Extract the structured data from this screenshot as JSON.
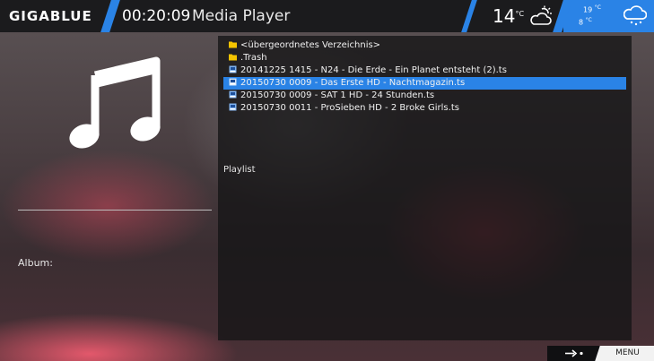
{
  "header": {
    "brand": "GIGABLUE",
    "clock": "00:20:09",
    "title": "Media Player",
    "temperature": "14",
    "temp_unit": "°C",
    "weather_icon": "cloud-sun-icon",
    "forecast": {
      "high": "19",
      "low": "8",
      "unit": "°C",
      "icon": "cloud-rain-icon"
    }
  },
  "info": {
    "cover_icon": "music-note-icon",
    "album_label": "Album:"
  },
  "filelist": {
    "items": [
      {
        "label": "<übergeordnetes Verzeichnis>",
        "icon": "folder-icon",
        "selected": false
      },
      {
        "label": ".Trash",
        "icon": "folder-icon",
        "selected": false
      },
      {
        "label": "20141225 1415 - N24 - Die Erde - Ein Planet entsteht (2).ts",
        "icon": "video-file-icon",
        "selected": false
      },
      {
        "label": "20150730 0009 - Das Erste HD - Nachtmagazin.ts",
        "icon": "video-file-icon",
        "selected": true
      },
      {
        "label": "20150730 0009 - SAT 1 HD - 24 Stunden.ts",
        "icon": "video-file-icon",
        "selected": false
      },
      {
        "label": "20150730 0011 - ProSieben HD - 2 Broke Girls.ts",
        "icon": "video-file-icon",
        "selected": false
      }
    ],
    "playlist_label": "Playlist"
  },
  "footer": {
    "arrow_icon": "arrow-right-dot-icon",
    "menu_label": "MENU"
  },
  "colors": {
    "accent": "#2a83e6",
    "topbar": "#1b1b1d",
    "folder": "#f5c400"
  }
}
